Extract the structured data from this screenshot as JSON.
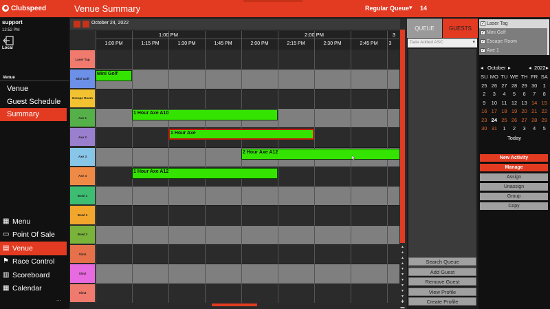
{
  "app": {
    "name": "Clubspeed",
    "page_title": "Venue Summary",
    "queue_name": "Regular Queue",
    "queue_count": "14"
  },
  "sidebar": {
    "user": "support",
    "time": "12:52 PM",
    "location": "Local",
    "section": "Venue",
    "sub_items": [
      {
        "label": "Venue",
        "active": false
      },
      {
        "label": "Guest Schedule",
        "active": false
      },
      {
        "label": "Summary",
        "active": true
      }
    ],
    "nav": [
      {
        "label": "Menu",
        "icon": "grid-icon",
        "active": false
      },
      {
        "label": "Point Of Sale",
        "icon": "pos-icon",
        "active": false
      },
      {
        "label": "Venue",
        "icon": "venue-icon",
        "active": true
      },
      {
        "label": "Race Control",
        "icon": "race-flag-icon",
        "active": false
      },
      {
        "label": "Scoreboard",
        "icon": "scoreboard-icon",
        "active": false
      },
      {
        "label": "Calendar",
        "icon": "calendar-icon",
        "active": false
      }
    ],
    "more": "..."
  },
  "schedule": {
    "date": "October 24, 2022",
    "hours": [
      "1:00 PM",
      "2:00 PM",
      "3"
    ],
    "quarters": [
      "1:00 PM",
      "1:15 PM",
      "1:30 PM",
      "1:45 PM",
      "2:00 PM",
      "2:15 PM",
      "2:30 PM",
      "2:45 PM",
      "3"
    ],
    "resources": [
      {
        "name": "Laser Tag",
        "color": "#f07a6e"
      },
      {
        "name": "Mini Golf",
        "color": "#6c8fe8"
      },
      {
        "name": "Escape Room",
        "color": "#f2c230"
      },
      {
        "name": "Axe 1",
        "color": "#55b04a"
      },
      {
        "name": "Axe 2",
        "color": "#9a7fcf"
      },
      {
        "name": "Axe 3",
        "color": "#88c6e8"
      },
      {
        "name": "Axe 4",
        "color": "#ee8a45"
      },
      {
        "name": "Bowl 1",
        "color": "#3dbd72"
      },
      {
        "name": "Bowl 2",
        "color": "#f3a62c"
      },
      {
        "name": "Bowl 3",
        "color": "#79b33a"
      },
      {
        "name": "Sim1",
        "color": "#e5704a"
      },
      {
        "name": "Sim2",
        "color": "#e86ae0"
      },
      {
        "name": "Sim3",
        "color": "#f07a6e"
      }
    ],
    "bookings": [
      {
        "label": "Mini Golf",
        "row": 1,
        "start": "1:00 PM",
        "end": "1:15 PM",
        "selected": false
      },
      {
        "label": "1 Hour Axe  A10",
        "row": 3,
        "start": "1:15 PM",
        "end": "2:15 PM",
        "selected": false
      },
      {
        "label": "1 Hour Axe",
        "row": 4,
        "start": "1:30 PM",
        "end": "2:30 PM",
        "selected": true
      },
      {
        "label": "2 Hour Axe  A12",
        "row": 5,
        "start": "2:00 PM",
        "end": "4:00 PM",
        "selected": false
      },
      {
        "label": "1 Hour Axe  A12",
        "row": 6,
        "start": "1:15 PM",
        "end": "2:15 PM",
        "selected": false
      }
    ]
  },
  "queue_panel": {
    "tab_queue": "QUEUE",
    "tab_guests": "GUESTS",
    "sort": "Date Added ASC",
    "buttons": [
      "Search Queue",
      "Add Guest",
      "Remove Guest",
      "View Profile",
      "Create Profile"
    ]
  },
  "right_panel": {
    "filters": [
      "Laser Tag",
      "Mini Golf",
      "Escape Room",
      "Axe 1"
    ],
    "calendar": {
      "month": "October",
      "year": "2022",
      "dows": [
        "SU",
        "MO",
        "TU",
        "WE",
        "TH",
        "FR",
        "SA"
      ],
      "weeks": [
        [
          "25",
          "26",
          "27",
          "28",
          "29",
          "30",
          "1"
        ],
        [
          "2",
          "3",
          "4",
          "5",
          "6",
          "7",
          "8"
        ],
        [
          "9",
          "10",
          "11",
          "12",
          "13",
          "14",
          "15"
        ],
        [
          "16",
          "17",
          "18",
          "19",
          "20",
          "21",
          "22"
        ],
        [
          "23",
          "24",
          "25",
          "26",
          "27",
          "28",
          "29"
        ],
        [
          "30",
          "31",
          "1",
          "2",
          "3",
          "4",
          "5"
        ]
      ],
      "today_label": "Today",
      "prev": "◂",
      "next": "▸"
    },
    "buttons": [
      {
        "label": "New Activity",
        "style": "red"
      },
      {
        "label": "Manage",
        "style": "red"
      },
      {
        "label": "Assign",
        "style": "gray"
      },
      {
        "label": "Unassign",
        "style": "gray"
      },
      {
        "label": "Group",
        "style": "gray"
      },
      {
        "label": "Copy",
        "style": "gray"
      }
    ]
  },
  "colors": {
    "accent": "#e23b22",
    "booking": "#34e400",
    "grid_alt": "#7f7f7f",
    "grid_plain": "#2b2b2b"
  }
}
